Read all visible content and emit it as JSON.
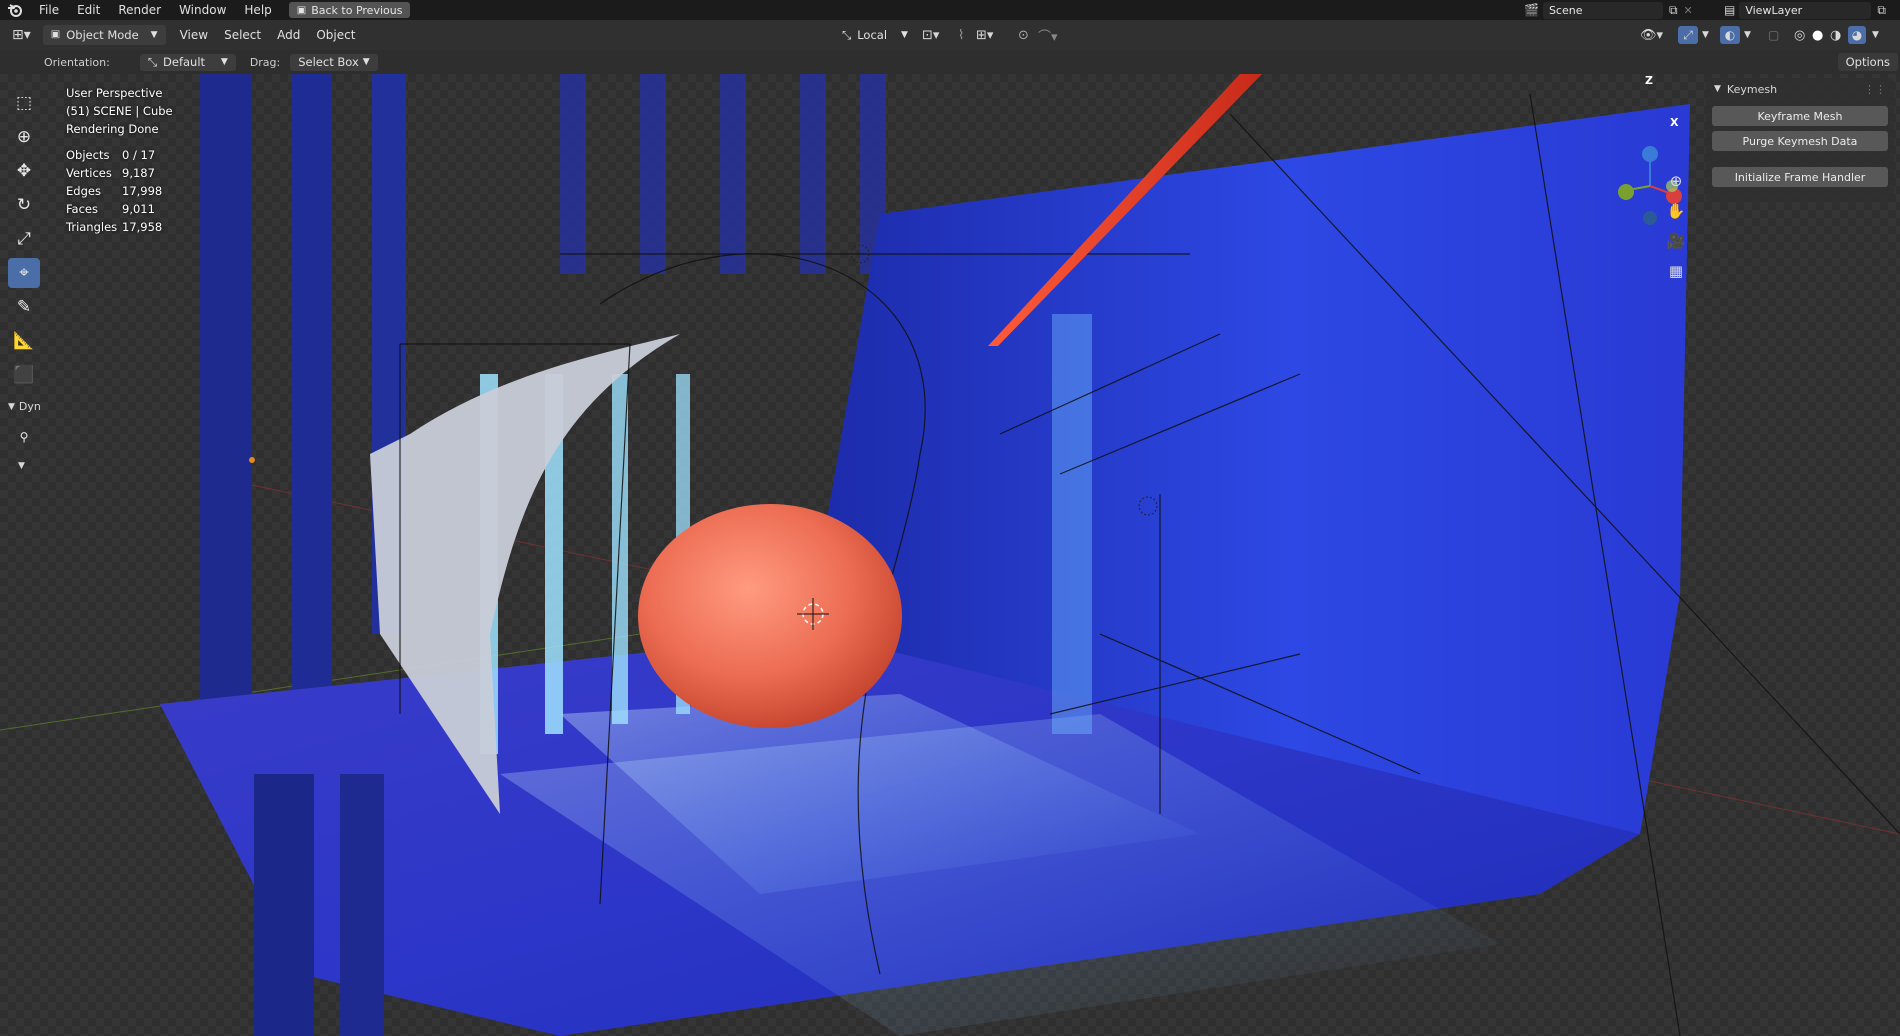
{
  "menu": {
    "items": [
      "File",
      "Edit",
      "Render",
      "Window",
      "Help"
    ],
    "back_button": "Back to Previous"
  },
  "scene": {
    "name": "Scene",
    "view_layer": "ViewLayer"
  },
  "header": {
    "mode": "Object Mode",
    "menus": [
      "View",
      "Select",
      "Add",
      "Object"
    ],
    "transform_space": "Local"
  },
  "tool_settings": {
    "orientation_label": "Orientation:",
    "orientation_value": "Default",
    "drag_label": "Drag:",
    "drag_value": "Select Box",
    "options_label": "Options"
  },
  "overlay": {
    "view_name": "User Perspective",
    "collection": "(51) SCENE | Cube",
    "status": "Rendering Done"
  },
  "stats": [
    {
      "label": "Objects",
      "value": "0 / 17"
    },
    {
      "label": "Vertices",
      "value": "9,187"
    },
    {
      "label": "Edges",
      "value": "17,998"
    },
    {
      "label": "Faces",
      "value": "9,011"
    },
    {
      "label": "Triangles",
      "value": "17,958"
    }
  ],
  "toolbar": {
    "tools": [
      "select-box-icon",
      "cursor-icon",
      "move-icon",
      "rotate-icon",
      "scale-icon",
      "transform-icon",
      "annotate-icon",
      "measure-icon",
      "add-cube-icon"
    ],
    "active_tool": "transform-icon",
    "dyn_label": "Dyn"
  },
  "keymesh_panel": {
    "title": "Keymesh",
    "buttons": [
      "Keyframe Mesh",
      "Purge Keymesh Data",
      "Initialize Frame Handler"
    ]
  },
  "gizmo": {
    "z": "Z",
    "x": "X"
  },
  "colors": {
    "active_tool": "#4b6ea8",
    "stage_blue": "#2a3ce0",
    "sphere": "#e8705a",
    "light": "#8fd8ff"
  }
}
